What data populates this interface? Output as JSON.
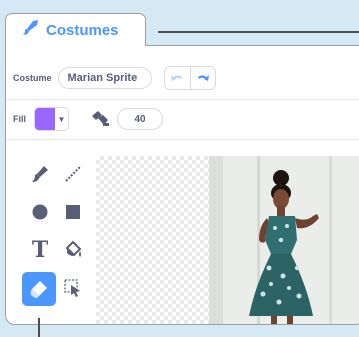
{
  "tab": {
    "label": "Costumes",
    "icon": "brush-icon"
  },
  "costume": {
    "label": "Costume",
    "name": "Marian Sprite"
  },
  "fill": {
    "label": "Fill",
    "color": "#9966ff"
  },
  "outline": {
    "size": "40"
  },
  "tools": [
    {
      "name": "brush",
      "icon": "brush-icon",
      "selected": false
    },
    {
      "name": "line",
      "icon": "line-icon",
      "selected": false
    },
    {
      "name": "circle",
      "icon": "circle-icon",
      "selected": false
    },
    {
      "name": "rectangle",
      "icon": "rectangle-icon",
      "selected": false
    },
    {
      "name": "text",
      "icon": "text-icon",
      "selected": false
    },
    {
      "name": "fill",
      "icon": "fill-bucket-icon",
      "selected": false
    },
    {
      "name": "eraser",
      "icon": "eraser-icon",
      "selected": true
    },
    {
      "name": "select",
      "icon": "select-icon",
      "selected": false
    }
  ],
  "colors": {
    "accent": "#4c97ff",
    "text": "#575e75"
  }
}
